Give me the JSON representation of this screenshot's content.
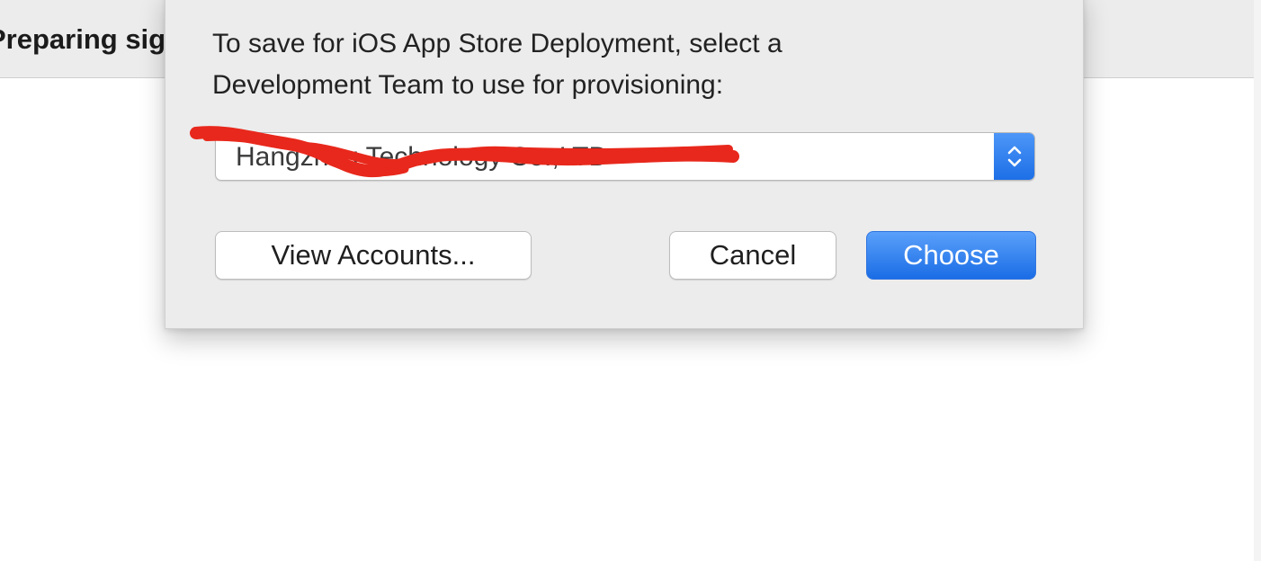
{
  "background": {
    "header_text": "Preparing signing"
  },
  "sheet": {
    "message_line1": "To save for iOS App Store Deployment, select a",
    "message_line2": "Development Team to use for provisioning:",
    "team_popup": {
      "selected_value": "Hangzhou Technology Co.,LTD"
    },
    "buttons": {
      "view_accounts": "View Accounts...",
      "cancel": "Cancel",
      "choose": "Choose"
    }
  },
  "colors": {
    "accent": "#1d6ee6",
    "redaction": "#e8281c",
    "sheet_background": "#ececec"
  },
  "icons": {
    "popup_arrows": "up-down-chevron-icon"
  }
}
